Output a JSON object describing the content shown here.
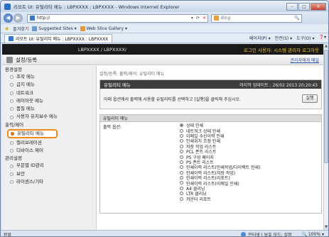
{
  "window": {
    "title": "리모트 UI: 유틸리티 메뉴 : LBPXXXX : LBPXXXX - Windows Internet Explorer"
  },
  "address": {
    "url": "http://",
    "search_placeholder": "Bing"
  },
  "favorites": {
    "label": "즐겨찾기",
    "suggested": "Suggested Sites ▾",
    "gallery": "Web Slice Gallery ▾"
  },
  "tab": {
    "label": "리모트 UI: 유틸리티 메뉴 : LBPXXXX : LBPXXXX"
  },
  "commands": [
    "페이지(P) ▾",
    "안전(S) ▾",
    "도구(O) ▾",
    "❓▾"
  ],
  "header": {
    "model": "LBPXXXX / LBPXXXX/",
    "login": "로그인 사용자: 시스템 관리자 로그아웃"
  },
  "subheader": {
    "title": "설정/등록",
    "admin_link": "관리자에게 메일"
  },
  "sidebar": {
    "sections": [
      {
        "title": "환경설정",
        "items": [
          "조작 메뉴",
          "급지 메뉴",
          "네트워크",
          "레이아웃 메뉴",
          "품질 메뉴",
          "사용자 유지보수 메뉴"
        ]
      },
      {
        "title": "출력/제어",
        "items": [
          "유틸리티 메뉴",
          "캘리브레이션",
          "디바이스 제어"
        ]
      },
      {
        "title": "관리설정",
        "items": [
          "부문별 ID관리",
          "보안",
          "라이센스/기타"
        ]
      }
    ],
    "active": "유틸리티 메뉴"
  },
  "main": {
    "breadcrumb": "설정/등록: 출력/제어: 유틸리티 메뉴",
    "box_title": "유틸리티 메뉴",
    "last_updated": "마지막 업데이트 : 26/02 2013 20:20:43",
    "message": "아래 옵션에서 출력에 사용할 유틸리티를 선택하고 [실행]을 클릭해 주십시오.",
    "apply_button": "실행",
    "section_title": "유틸리티 메뉴",
    "output_label": "출력 옵션:",
    "options": [
      "상태 인쇄",
      "네트워크 상태 인쇄",
      "이메일 수신이력 인쇄",
      "인쇄위치 조정 인쇄",
      "저장 작업 리스트",
      "PCL 폰트 리스트",
      "PS 구성 페이지",
      "PS 폰트 리스트",
      "인쇄이력 리스트(인쇄작업/다이렉트 인쇄)",
      "인쇄이력 리스트(저장 작업)",
      "인쇄이력 리스트(리포트)",
      "인쇄이력 리스트(이메일 인쇄)",
      "A4 클리닝",
      "LTR 클리닝",
      "카운터 리포트"
    ],
    "selected_index": 0
  },
  "status": {
    "left": "완료",
    "zone": "인터넷 | 보호 모드: 설정",
    "zoom": "🔍 100% ▾"
  }
}
